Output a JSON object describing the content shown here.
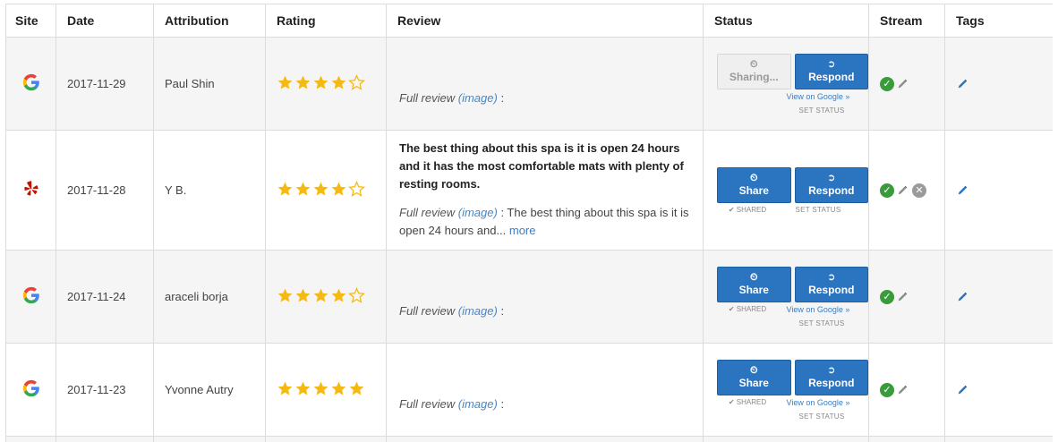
{
  "headers": [
    "Site",
    "Date",
    "Attribution",
    "Rating",
    "Review",
    "Status",
    "Stream",
    "Tags"
  ],
  "rows": [
    {
      "site": "google",
      "date": "2017-11-29",
      "attribution": "Paul Shin",
      "rating": 4,
      "review_body": "",
      "full_review_prefix": "Full review",
      "image_link": "(image)",
      "full_review_text": " :",
      "more": "",
      "share_label": "Sharing...",
      "share_state": "disabled",
      "respond_label": "Respond",
      "shared_label": "",
      "view_on_google": "View on Google »",
      "set_status": "SET STATUS",
      "stream_remove": false
    },
    {
      "site": "yelp",
      "date": "2017-11-28",
      "attribution": "Y B.",
      "rating": 4,
      "review_body": "The best thing about this spa is it is open 24 hours and it has the most comfortable mats with plenty of resting rooms.",
      "full_review_prefix": "Full review",
      "image_link": "(image)",
      "full_review_text": " : The best thing about this spa is it is open 24 hours and...",
      "more": " more",
      "share_label": "Share",
      "share_state": "active",
      "respond_label": "Respond",
      "shared_label": "✔ SHARED",
      "view_on_google": "",
      "set_status": "SET STATUS",
      "stream_remove": true
    },
    {
      "site": "google",
      "date": "2017-11-24",
      "attribution": "araceli borja",
      "rating": 4,
      "review_body": "",
      "full_review_prefix": "Full review",
      "image_link": "(image)",
      "full_review_text": " :",
      "more": "",
      "share_label": "Share",
      "share_state": "active",
      "respond_label": "Respond",
      "shared_label": "✔ SHARED",
      "view_on_google": "View on Google »",
      "set_status": "SET STATUS",
      "stream_remove": false
    },
    {
      "site": "google",
      "date": "2017-11-23",
      "attribution": "Yvonne Autry",
      "rating": 5,
      "review_body": "",
      "full_review_prefix": "Full review",
      "image_link": "(image)",
      "full_review_text": " :",
      "more": "",
      "share_label": "Share",
      "share_state": "active",
      "respond_label": "Respond",
      "shared_label": "✔ SHARED",
      "view_on_google": "View on Google »",
      "set_status": "SET STATUS",
      "stream_remove": false
    }
  ],
  "icons": {
    "clock": "clock-icon",
    "respond": "arrow-circle-icon",
    "check": "check-circle-icon",
    "pencil": "pencil-icon",
    "remove": "x-circle-icon",
    "tag_edit": "pencil-icon"
  },
  "colors": {
    "button": "#2b74c0",
    "star": "#f6b90f",
    "check": "#3a9b3a",
    "link": "#4a86c5"
  }
}
